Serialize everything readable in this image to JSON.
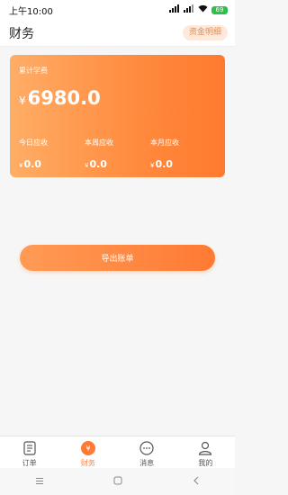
{
  "status_bar": {
    "time": "上午10:00",
    "battery": "69"
  },
  "header": {
    "title": "财务",
    "detail_button": "资金明细"
  },
  "summary": {
    "total_label": "累计学费",
    "currency": "¥",
    "total_amount": "6980.0",
    "stats": [
      {
        "label": "今日应收",
        "currency": "¥",
        "value": "0.0"
      },
      {
        "label": "本周应收",
        "currency": "¥",
        "value": "0.0"
      },
      {
        "label": "本月应收",
        "currency": "¥",
        "value": "0.0"
      }
    ]
  },
  "export_button": "导出账单",
  "tabs": [
    {
      "label": "订单",
      "icon": "order-icon",
      "active": false
    },
    {
      "label": "财务",
      "icon": "finance-icon",
      "active": true
    },
    {
      "label": "消息",
      "icon": "message-icon",
      "active": false
    },
    {
      "label": "我的",
      "icon": "profile-icon",
      "active": false
    }
  ],
  "navbar": {
    "menu_icon": "menu-icon",
    "home_icon": "home-icon",
    "back_icon": "back-icon"
  },
  "colors": {
    "accent": "#ff7a33",
    "card_gradient_start": "#ffad66",
    "card_gradient_end": "#ff7a2f"
  }
}
